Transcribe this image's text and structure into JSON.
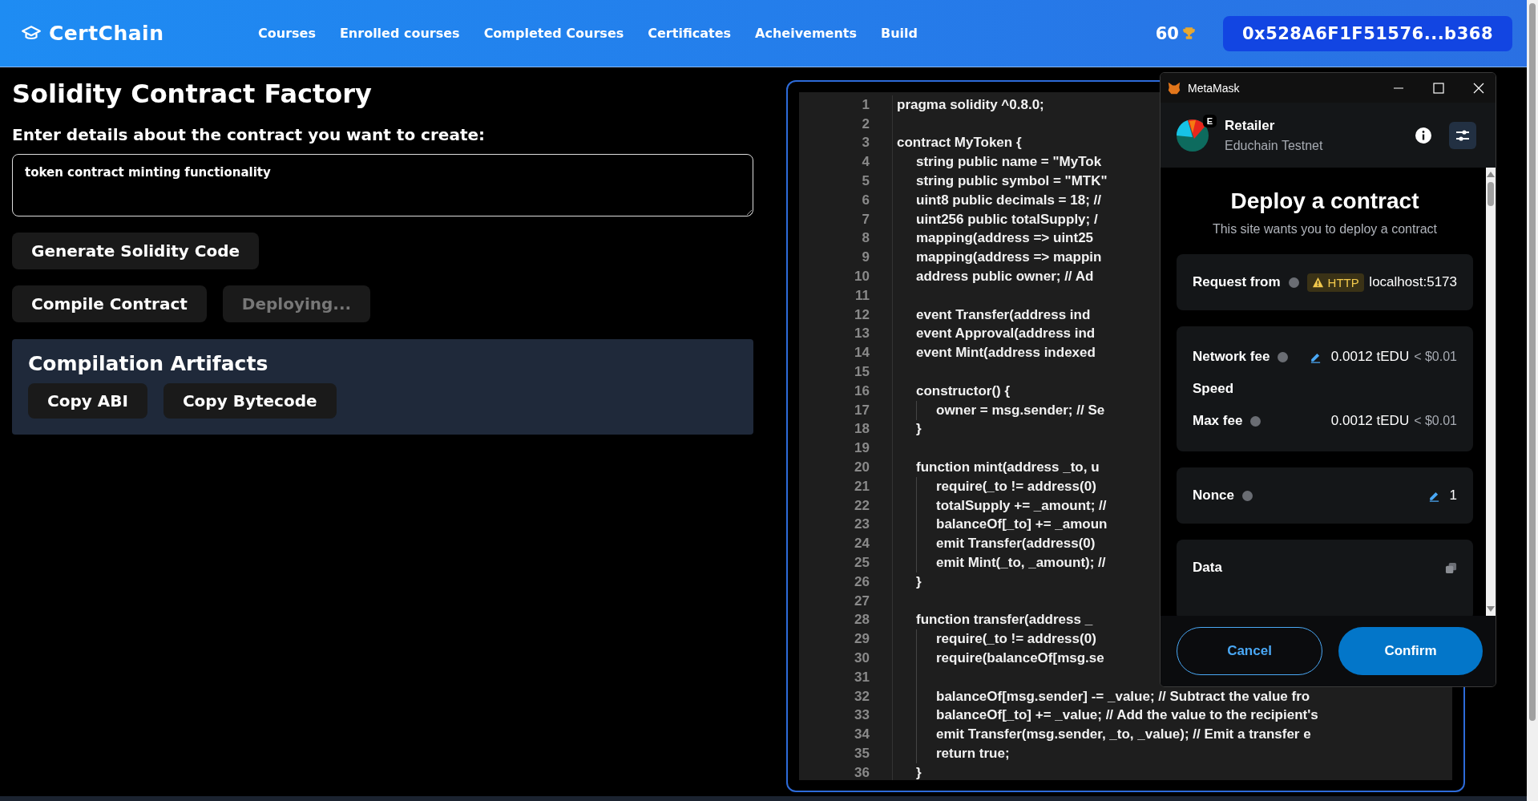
{
  "nav": {
    "brand": "CertChain",
    "links": [
      {
        "label": "Courses"
      },
      {
        "label": "Enrolled courses"
      },
      {
        "label": "Completed Courses"
      },
      {
        "label": "Certificates"
      },
      {
        "label": "Acheivements"
      },
      {
        "label": "Build"
      }
    ],
    "points": "60",
    "wallet": "0x528A6F1F51576...b368"
  },
  "factory": {
    "title": "Solidity Contract Factory",
    "prompt_label": "Enter details about the contract you want to create:",
    "prompt_value": "token contract minting functionality",
    "generate_button": {
      "label": "Generate Solidity Code",
      "disabled": false
    },
    "action_buttons": [
      {
        "label": "Compile Contract",
        "disabled": false
      },
      {
        "label": "Deploying...",
        "disabled": true
      }
    ]
  },
  "artifacts": {
    "title": "Compilation Artifacts",
    "buttons": [
      {
        "label": "Copy ABI"
      },
      {
        "label": "Copy Bytecode"
      }
    ]
  },
  "editor": {
    "lines": [
      {
        "num": "1",
        "code": "pragma solidity ^0.8.0;"
      },
      {
        "num": "2"
      },
      {
        "num": "3",
        "code": "contract MyToken {",
        "children": [
          {
            "num": "4",
            "code": "string public name = \"MyTok"
          },
          {
            "num": "5",
            "code": "string public symbol = \"MTK\""
          },
          {
            "num": "6",
            "code": "uint8 public decimals = 18; //"
          },
          {
            "num": "7",
            "code": "uint256 public totalSupply; /"
          },
          {
            "num": "8",
            "code": "mapping(address => uint25"
          },
          {
            "num": "9",
            "code": "mapping(address => mappin"
          },
          {
            "num": "10",
            "code": "address public owner; // Ad"
          },
          {
            "num": "11"
          },
          {
            "num": "12",
            "code": "event Transfer(address ind"
          },
          {
            "num": "13",
            "code": "event Approval(address ind"
          },
          {
            "num": "14",
            "code": "event Mint(address indexed"
          },
          {
            "num": "15"
          },
          {
            "num": "16",
            "code": "constructor() {",
            "children": [
              {
                "num": "17",
                "code": "owner = msg.sender; // Se"
              }
            ]
          },
          {
            "num": "18",
            "code": "}"
          },
          {
            "num": "19"
          },
          {
            "num": "20",
            "code": "function mint(address _to, u",
            "children": [
              {
                "num": "21",
                "code": "require(_to != address(0)"
              },
              {
                "num": "22",
                "code": "totalSupply += _amount; //"
              },
              {
                "num": "23",
                "code": "balanceOf[_to] += _amoun"
              },
              {
                "num": "24",
                "code": "emit Transfer(address(0)"
              },
              {
                "num": "25",
                "code": "emit Mint(_to, _amount); //"
              }
            ]
          },
          {
            "num": "26",
            "code": "}"
          },
          {
            "num": "27"
          },
          {
            "num": "28",
            "code": "function transfer(address _",
            "children": [
              {
                "num": "29",
                "code": "require(_to != address(0)"
              },
              {
                "num": "30",
                "code": "require(balanceOf[msg.se"
              },
              {
                "num": "31"
              },
              {
                "num": "32",
                "code": "balanceOf[msg.sender] -= _value; // Subtract the value fro"
              },
              {
                "num": "33",
                "code": "balanceOf[_to] += _value; // Add the value to the recipient's"
              },
              {
                "num": "34",
                "code": "emit Transfer(msg.sender, _to, _value); // Emit a transfer e"
              },
              {
                "num": "35",
                "code": "return true;"
              }
            ]
          },
          {
            "num": "36",
            "code": "}"
          }
        ]
      }
    ]
  },
  "metamask": {
    "title": "MetaMask",
    "account": "Retailer",
    "network": "Educhain Testnet",
    "network_badge": "E",
    "heading": "Deploy a contract",
    "subheading": "This site wants you to deploy a contract",
    "request": {
      "label": "Request from",
      "badge": "HTTP",
      "origin": "localhost:5173"
    },
    "fees": [
      {
        "kind": "editable",
        "label": "Network fee",
        "amount": "0.0012 tEDU",
        "fiat": "< $0.01",
        "help": true
      },
      {
        "kind": "label",
        "label": "Speed",
        "help": false
      },
      {
        "kind": "value",
        "label": "Max fee",
        "amount": "0.0012 tEDU",
        "fiat": "< $0.01",
        "help": true
      }
    ],
    "nonce": {
      "label": "Nonce",
      "value": "1"
    },
    "data": {
      "label": "Data"
    },
    "cancel": "Cancel",
    "confirm": "Confirm"
  }
}
